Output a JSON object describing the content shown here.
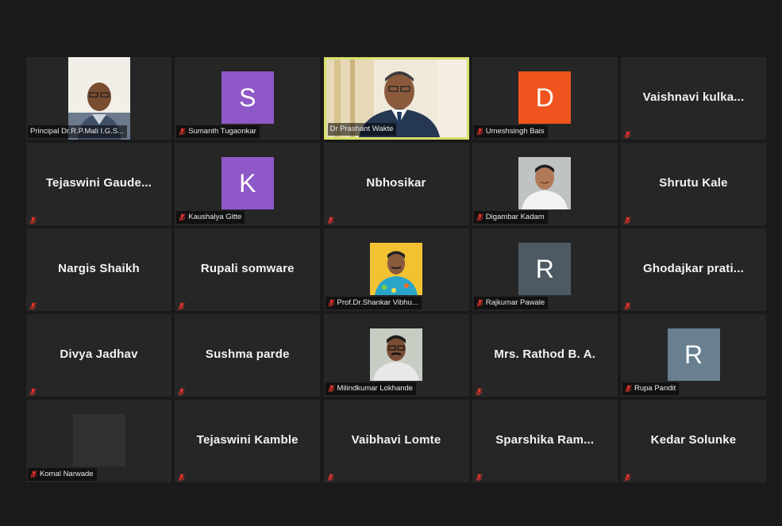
{
  "participants": [
    {
      "name": "Principal Dr.R.P.Mali I.G.S...",
      "type": "video",
      "icon": "person-photo-man-glasses",
      "muted": false
    },
    {
      "name": "Sumanth Tugaonkar",
      "type": "avatar",
      "initial": "S",
      "color": "#8e58c9",
      "muted": true
    },
    {
      "name": "Dr Prashant Wakte",
      "type": "active-video",
      "icon": "person-photo-man-suit",
      "muted": false
    },
    {
      "name": "Umeshsingh Bais",
      "type": "avatar",
      "initial": "D",
      "color": "#f0541e",
      "muted": true
    },
    {
      "display": "Vaishnavi  kulka...",
      "type": "name-only",
      "muted": true
    },
    {
      "display": "Tejaswini  Gaude...",
      "type": "name-only",
      "muted": true
    },
    {
      "name": "Kaushalya Gitte",
      "type": "avatar",
      "initial": "K",
      "color": "#8e58c9",
      "muted": true
    },
    {
      "display": "Nbhosikar",
      "type": "name-only",
      "muted": true
    },
    {
      "name": "Digambar Kadam",
      "type": "photo",
      "icon": "person-photo-man-smiling",
      "muted": true
    },
    {
      "display": "Shrutu Kale",
      "type": "name-only",
      "muted": true
    },
    {
      "display": "Nargis Shaikh",
      "type": "name-only",
      "muted": true
    },
    {
      "display": "Rupali somware",
      "type": "name-only",
      "muted": true
    },
    {
      "name": "Prof.Dr.Shankar Vibhu...",
      "type": "photo",
      "icon": "person-photo-cartoon",
      "muted": true
    },
    {
      "name": "Rajkumar Pawale",
      "type": "avatar",
      "initial": "R",
      "color": "#4e5a63",
      "muted": true
    },
    {
      "display": "Ghodajkar  prati...",
      "type": "name-only",
      "muted": true
    },
    {
      "display": "Divya Jadhav",
      "type": "name-only",
      "muted": true
    },
    {
      "display": "Sushma parde",
      "type": "name-only",
      "muted": true
    },
    {
      "name": "Milindkumar Lokhande",
      "type": "photo",
      "icon": "person-photo-man-mustache",
      "muted": true
    },
    {
      "display": "Mrs. Rathod B. A.",
      "type": "name-only",
      "muted": true
    },
    {
      "name": "Rupa Pandit",
      "type": "avatar",
      "initial": "R",
      "color": "#68808f",
      "muted": true
    },
    {
      "name": "Komal Narwade",
      "type": "photo",
      "icon": "dark-placeholder",
      "muted": true
    },
    {
      "display": "Tejaswini  Kamble",
      "type": "name-only",
      "muted": true
    },
    {
      "display": "Vaibhavi Lomte",
      "type": "name-only",
      "muted": true
    },
    {
      "display": "Sparshika  Ram...",
      "type": "name-only",
      "muted": true
    },
    {
      "display": "Kedar Solunke",
      "type": "name-only",
      "muted": true
    }
  ],
  "colors": {
    "background": "#1a1a1a",
    "tile": "#262626",
    "active_border": "#d7e06a",
    "mute_red": "#e0332b"
  }
}
